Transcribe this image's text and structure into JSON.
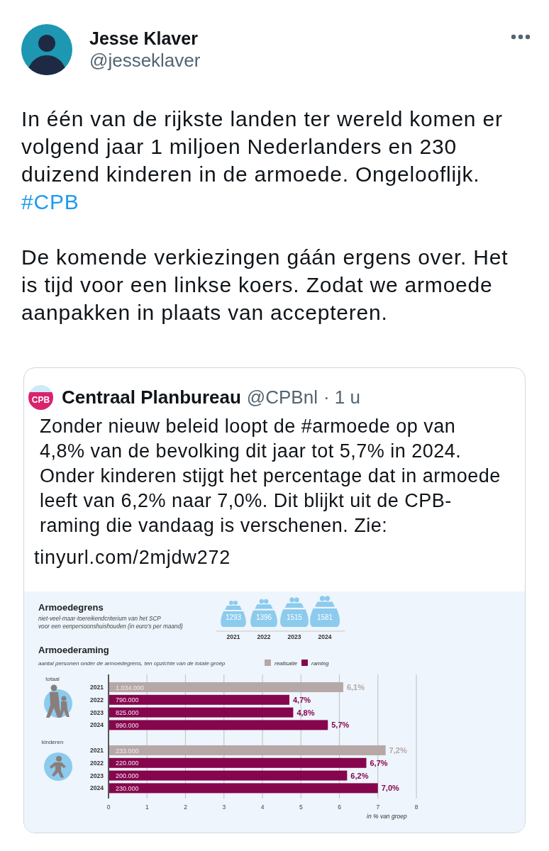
{
  "author": {
    "name": "Jesse Klaver",
    "handle": "@jesseklaver"
  },
  "tweet": {
    "paragraphs": [
      {
        "lines": [
          "In één van de rijkste landen ter wereld komen er",
          "volgend jaar 1 miljoen Nederlanders en 230",
          "duizend kinderen in de armoede. Ongelooflijk."
        ],
        "hashtag": "#CPB"
      },
      {
        "lines": [
          "De komende verkiezingen gáán ergens over. Het",
          "is tijd voor een linkse koers. Zodat we armoede",
          "aanpakken in plaats van accepteren."
        ]
      }
    ]
  },
  "quote": {
    "logo_text": "CPB",
    "name": "Centraal Planbureau",
    "handle": "@CPBnl",
    "time": "· 1 u",
    "lines": [
      "Zonder nieuw beleid loopt de #armoede op van",
      "4,8% van de bevolking dit jaar tot 5,7% in 2024.",
      "Onder kinderen stijgt het percentage dat in armoede",
      "leeft van 6,2% naar 7,0%.  Dit blijkt uit de CPB-",
      "raming die vandaag is verschenen. Zie:"
    ],
    "link": "tinyurl.com/2mjdw272",
    "image": {
      "threshold": {
        "title": "Armoedegrens",
        "subtitle": [
          "niet-veel-maar-toereikendcriterium van het SCP",
          "voor een eenpersoonshuishouden (in euro's per maand)"
        ],
        "purses": [
          {
            "amount": "1293",
            "year": "2021"
          },
          {
            "amount": "1396",
            "year": "2022"
          },
          {
            "amount": "1515",
            "year": "2023"
          },
          {
            "amount": "1581",
            "year": "2024"
          }
        ]
      },
      "estimate": {
        "title": "Armoederaming",
        "subtitle": "aantal personen onder de armoedegrens, ten opzichte van de totale groep",
        "groups": [
          {
            "label": "totaal",
            "kind": "adults"
          },
          {
            "label": "kinderen",
            "kind": "children"
          }
        ],
        "counts": [
          "1.034.000",
          "790.000",
          "825.000",
          "990.000",
          "233.000",
          "220.000",
          "200.000",
          "230.000"
        ],
        "chart_data": {
          "type": "bar",
          "orientation": "horizontal",
          "xlabel": "in % van groep",
          "categories": [
            "2021",
            "2022",
            "2023",
            "2024",
            "2021",
            "2022",
            "2023",
            "2024"
          ],
          "series": [
            {
              "name": "realisatie",
              "color": "#b5a8a6",
              "values": [
                6.1,
                null,
                null,
                null,
                7.2,
                null,
                null,
                null
              ]
            },
            {
              "name": "raming",
              "color": "#86064d",
              "values": [
                null,
                4.7,
                4.8,
                5.7,
                null,
                6.7,
                6.2,
                7.0
              ]
            }
          ],
          "xlim": [
            0,
            8
          ],
          "grid": true,
          "xticks": [
            0,
            1,
            2,
            3,
            4,
            5,
            6,
            7,
            8
          ],
          "value_labels": [
            "6,1%",
            "4,7%",
            "4,8%",
            "5,7%",
            "7,2%",
            "6,7%",
            "6,2%",
            "7,0%"
          ]
        }
      }
    }
  }
}
